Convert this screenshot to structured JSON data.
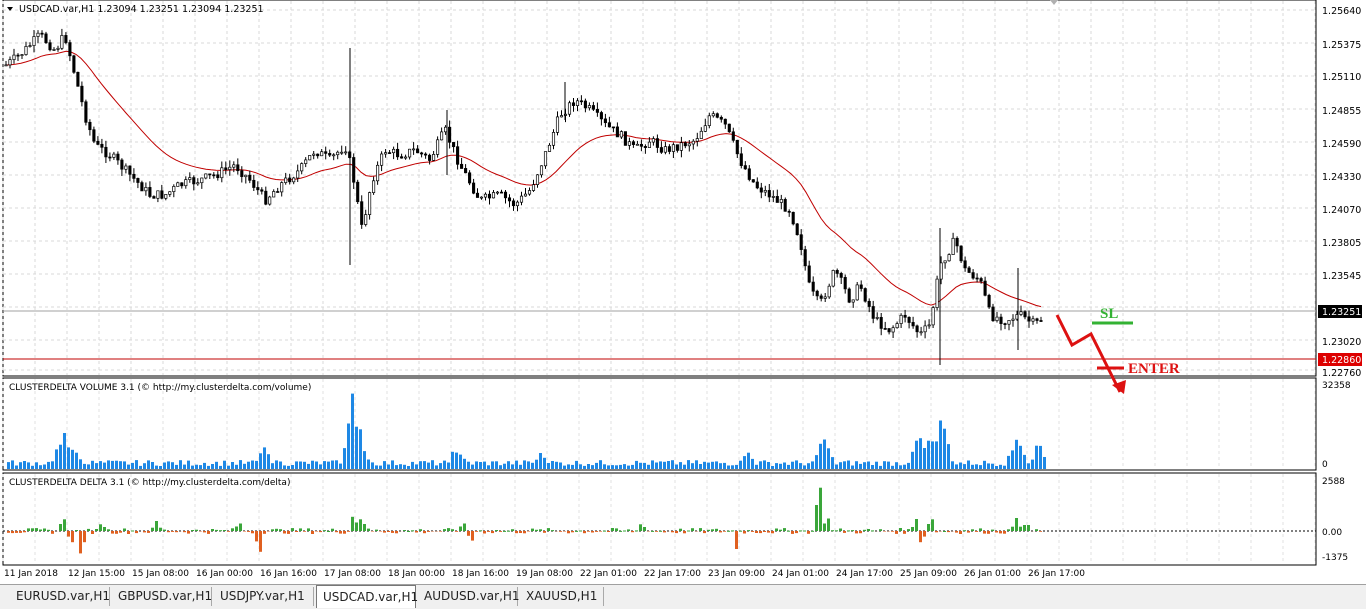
{
  "main_chart": {
    "title": "USDCAD.var,H1  1.23094 1.23251 1.23094 1.23251",
    "price_labels": [
      "1.25640",
      "1.25375",
      "1.25110",
      "1.24855",
      "1.24590",
      "1.24330",
      "1.24070",
      "1.23805",
      "1.23545",
      "1.23020",
      "1.22760"
    ],
    "current_price": "1.23251",
    "line_price": "1.22860",
    "colors": {
      "bull_bar": "#000000",
      "ma_line": "#c00000",
      "hline": "#c00000",
      "current_tag": "#000000",
      "red_tag": "#dd0000"
    }
  },
  "annotations": {
    "sl_label": "SL",
    "enter_label": "ENTER",
    "sl_color": "#33b233",
    "enter_color": "#dd1111"
  },
  "volume_panel": {
    "title": "CLUSTERDELTA VOLUME 3.1 (© http://my.clusterdelta.com/volume)",
    "max_label": "32358",
    "min_label": "0",
    "bar_color": "#1e88e5"
  },
  "delta_panel": {
    "title": "CLUSTERDELTA DELTA 3.1 (© http://my.clusterdelta.com/delta)",
    "labels": [
      "2588",
      "0.00",
      "-1375"
    ],
    "pos_color": "#3aa63a",
    "neg_color": "#e06020"
  },
  "time_labels": [
    "11 Jan 2018",
    "12 Jan 15:00",
    "15 Jan 08:00",
    "16 Jan 00:00",
    "16 Jan 16:00",
    "17 Jan 08:00",
    "18 Jan 00:00",
    "18 Jan 16:00",
    "19 Jan 08:00",
    "22 Jan 01:00",
    "22 Jan 17:00",
    "23 Jan 09:00",
    "24 Jan 01:00",
    "24 Jan 17:00",
    "25 Jan 09:00",
    "26 Jan 01:00",
    "26 Jan 17:00"
  ],
  "tabs": [
    {
      "label": "EURUSD.var,H1",
      "active": false
    },
    {
      "label": "GBPUSD.var,H1",
      "active": false
    },
    {
      "label": "USDJPY.var,H1",
      "active": false
    },
    {
      "label": "USDCAD.var,H1",
      "active": true
    },
    {
      "label": "AUDUSD.var,H1",
      "active": false
    },
    {
      "label": "XAUUSD,H1",
      "active": false
    }
  ]
}
